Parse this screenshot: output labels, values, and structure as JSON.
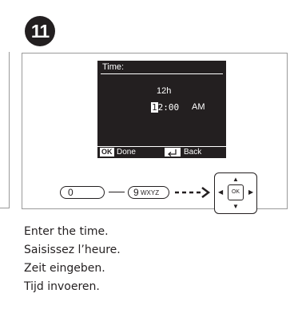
{
  "step": "11",
  "screen": {
    "title": "Time:",
    "format": "12h",
    "time_cursor_digit": "1",
    "time_rest": "2:00",
    "ampm": "AM",
    "ok_chip": "OK",
    "done_label": "Done",
    "back_label": "Back",
    "back_icon": "back-arrow-icon"
  },
  "keys": {
    "zero": "0",
    "nine_num": "9",
    "nine_letters": "WXYZ",
    "ok": "OK"
  },
  "instructions": [
    "Enter the time.",
    "Saisissez l’heure.",
    "Zeit eingeben.",
    "Tijd invoeren."
  ]
}
